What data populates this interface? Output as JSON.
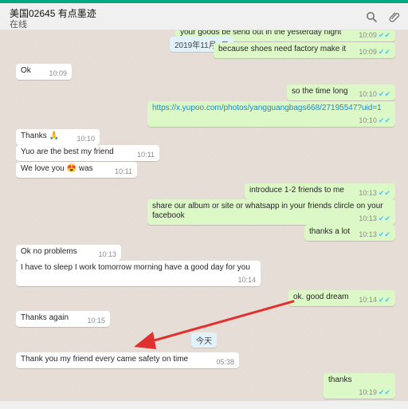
{
  "header": {
    "title": "美国02645 有点墨迹",
    "status": "在线",
    "search_icon": "search-icon",
    "attach_icon": "paperclip-icon"
  },
  "date_pills": [
    "2019年11月3日",
    "今天"
  ],
  "messages": [
    {
      "text": "your goods be send out in the yesterday night",
      "time": "10:09"
    },
    {
      "text": "because shoes need factory make it",
      "time": "10:09"
    },
    {
      "text": "Ok",
      "time": "10:09"
    },
    {
      "text": "so the time long",
      "time": "10:10"
    },
    {
      "text": "https://x.yupoo.com/photos/yangguangbags668/27195547?uid=1",
      "time": "10:10"
    },
    {
      "text": "Thanks 🙏",
      "time": "10:10"
    },
    {
      "text": "Yuo are the best my friend",
      "time": "10:11"
    },
    {
      "text": "We love you 😍 was",
      "time": "10:11"
    },
    {
      "text": "introduce 1-2 friends to me",
      "time": "10:13"
    },
    {
      "text": "share our album or site or whatsapp in your friends clircle  on your facebook",
      "time": "10:13"
    },
    {
      "text": "thanks a lot",
      "time": "10:13"
    },
    {
      "text": "Ok no problems",
      "time": "10:13"
    },
    {
      "text": "I have to sleep I work tomorrow morning have a good day for you",
      "time": "10:14"
    },
    {
      "text": "ok. good dream",
      "time": "10:14"
    },
    {
      "text": "Thanks again",
      "time": "10:15"
    },
    {
      "text": "Thank you my friend every came safety on time",
      "time": "05:38"
    },
    {
      "text": "thanks",
      "time": "10:19"
    }
  ],
  "colors": {
    "incoming_bubble": "#ffffff",
    "outgoing_bubble": "#dcf8c6",
    "chat_background": "#e6ded6",
    "read_tick": "#4fc3f7",
    "annotation_arrow": "#e03030"
  }
}
